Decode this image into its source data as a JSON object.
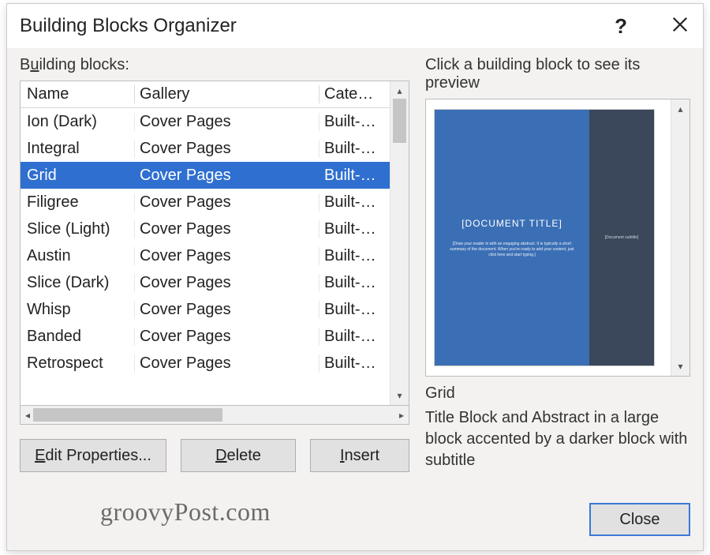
{
  "dialog": {
    "title": "Building Blocks Organizer",
    "help_tooltip": "?",
    "close_tooltip": "Close"
  },
  "left": {
    "label_pre": "B",
    "label_under": "u",
    "label_post": "ilding blocks:",
    "columns": {
      "name": "Name",
      "gallery": "Gallery",
      "category": "Cate…"
    },
    "rows": [
      {
        "name": "Ion (Dark)",
        "gallery": "Cover Pages",
        "category": "Built-…",
        "selected": false
      },
      {
        "name": "Integral",
        "gallery": "Cover Pages",
        "category": "Built-…",
        "selected": false
      },
      {
        "name": "Grid",
        "gallery": "Cover Pages",
        "category": "Built-…",
        "selected": true
      },
      {
        "name": "Filigree",
        "gallery": "Cover Pages",
        "category": "Built-…",
        "selected": false
      },
      {
        "name": "Slice (Light)",
        "gallery": "Cover Pages",
        "category": "Built-…",
        "selected": false
      },
      {
        "name": "Austin",
        "gallery": "Cover Pages",
        "category": "Built-…",
        "selected": false
      },
      {
        "name": "Slice (Dark)",
        "gallery": "Cover Pages",
        "category": "Built-…",
        "selected": false
      },
      {
        "name": "Whisp",
        "gallery": "Cover Pages",
        "category": "Built-…",
        "selected": false
      },
      {
        "name": "Banded",
        "gallery": "Cover Pages",
        "category": "Built-…",
        "selected": false
      },
      {
        "name": "Retrospect",
        "gallery": "Cover Pages",
        "category": "Built-…",
        "selected": false
      }
    ],
    "buttons": {
      "edit_under": "E",
      "edit_rest": "dit Properties...",
      "delete_under": "D",
      "delete_rest": "elete",
      "insert_under": "I",
      "insert_rest": "nsert"
    }
  },
  "right": {
    "label": "Click a building block to see its preview",
    "preview": {
      "doctitle": "[DOCUMENT TITLE]",
      "abstract": "[Draw your reader in with an engaging abstract. It is typically a short summary of the document. When you're ready to add your content, just click here and start typing.]",
      "subtitle": "[Document subtitle]"
    },
    "selected_name": "Grid",
    "selected_desc": "Title Block and Abstract in a large block accented by a darker block with subtitle",
    "close_label": "Close"
  },
  "watermark": "groovyPost.com"
}
